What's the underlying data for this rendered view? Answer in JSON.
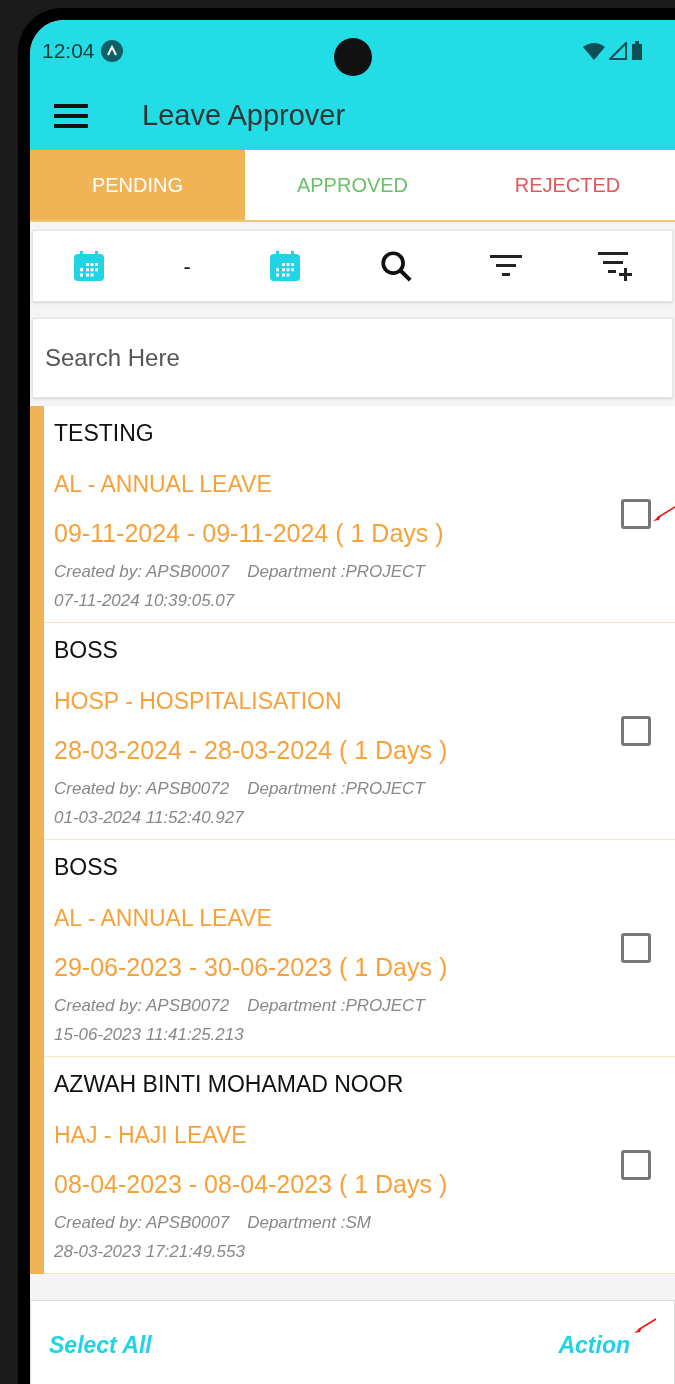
{
  "status_bar": {
    "time": "12:04"
  },
  "app_bar": {
    "title": "Leave Approver"
  },
  "tabs": [
    {
      "label": "PENDING",
      "selected": true,
      "kind": "pending"
    },
    {
      "label": "APPROVED",
      "selected": false,
      "kind": "approved"
    },
    {
      "label": "REJECTED",
      "selected": false,
      "kind": "rejected"
    }
  ],
  "date_filter": {
    "separator": "-"
  },
  "search": {
    "placeholder": "Search Here"
  },
  "requests": [
    {
      "name": "TESTING",
      "leave_type": "AL - ANNUAL LEAVE",
      "period": "09-11-2024 - 09-11-2024 ( 1 Days )",
      "created_by": "Created by: APSB0007",
      "department": "Department :PROJECT",
      "timestamp": "07-11-2024 10:39:05.07",
      "checked": false,
      "annotated": true
    },
    {
      "name": "BOSS",
      "leave_type": "HOSP - HOSPITALISATION",
      "period": "28-03-2024 - 28-03-2024 ( 1 Days )",
      "created_by": "Created by: APSB0072",
      "department": "Department :PROJECT",
      "timestamp": "01-03-2024 11:52:40.927",
      "checked": false,
      "annotated": false
    },
    {
      "name": "BOSS",
      "leave_type": "AL - ANNUAL LEAVE",
      "period": "29-06-2023 - 30-06-2023 ( 1 Days )",
      "created_by": "Created by: APSB0072",
      "department": "Department :PROJECT",
      "timestamp": "15-06-2023 11:41:25.213",
      "checked": false,
      "annotated": false
    },
    {
      "name": "AZWAH BINTI MOHAMAD NOOR",
      "leave_type": "HAJ - HAJI LEAVE",
      "period": "08-04-2023 - 08-04-2023 ( 1 Days )",
      "created_by": "Created by: APSB0007",
      "department": "Department :SM",
      "timestamp": "28-03-2023 17:21:49.553",
      "checked": false,
      "annotated": false
    }
  ],
  "bottom_bar": {
    "select_all": "Select All",
    "action": "Action",
    "action_annotated": true
  }
}
